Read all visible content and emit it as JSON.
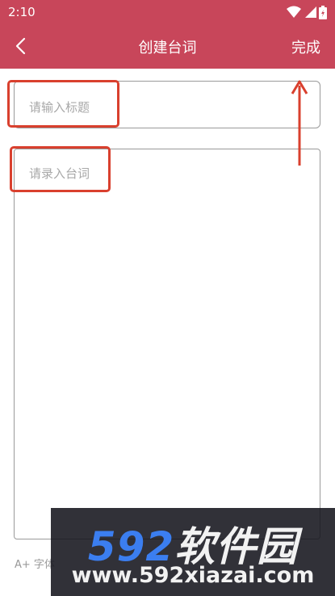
{
  "status_bar": {
    "time": "2:10",
    "icons": [
      "wifi-icon",
      "signal-icon",
      "battery-icon"
    ]
  },
  "app_bar": {
    "title": "创建台词",
    "back_icon": "chevron-left-icon",
    "done_label": "完成"
  },
  "form": {
    "title_placeholder": "请输入标题",
    "content_placeholder": "请录入台词"
  },
  "toolbar": {
    "font_size_label": "A+ 字体"
  },
  "watermark": {
    "logo_number": "592",
    "logo_text": "软件园",
    "url": "www.592xiazai.com"
  },
  "colors": {
    "header": "#c8465a",
    "highlight": "#d9402e",
    "placeholder": "#a8a8a8"
  }
}
